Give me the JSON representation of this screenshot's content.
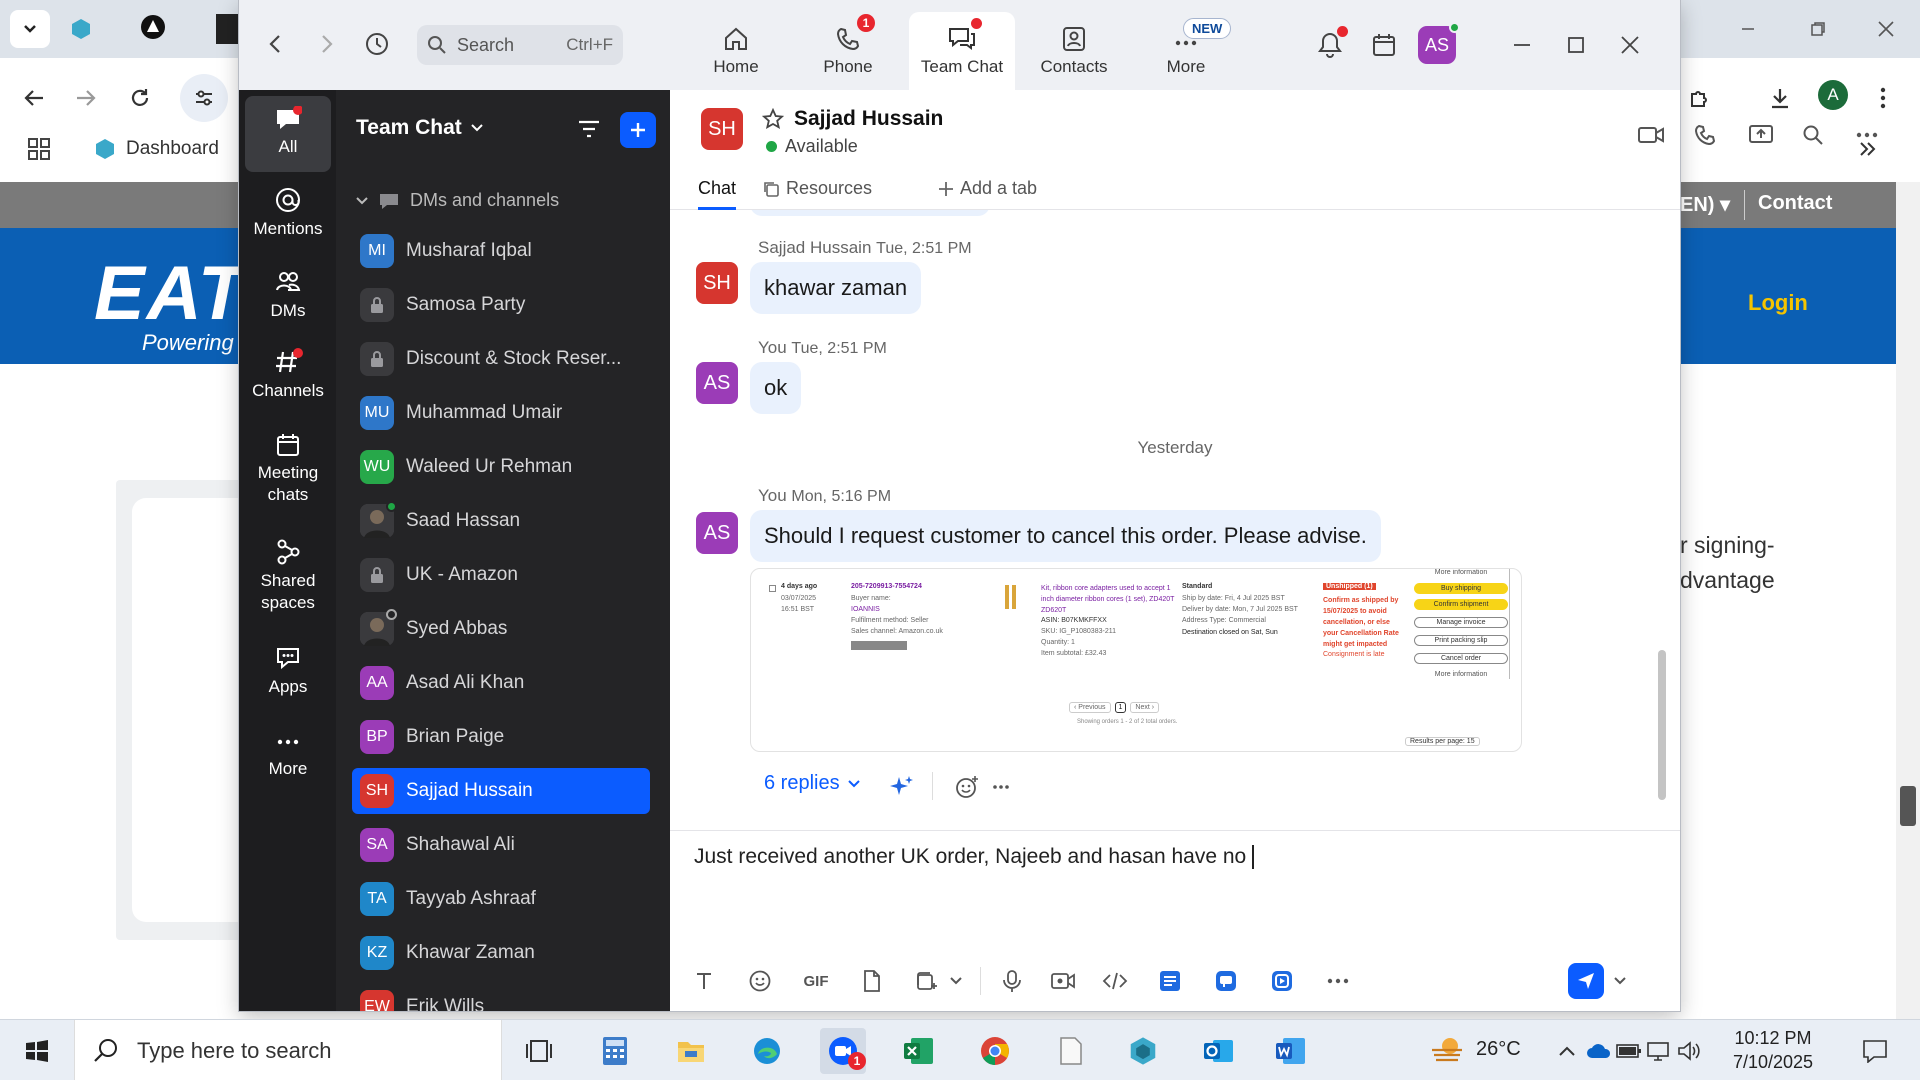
{
  "browser": {
    "bookmark_label": "Dashboard",
    "site_login": "Login",
    "site_contact": "Contact",
    "site_lang": "EN)",
    "site_logo_text": "EAT",
    "site_logo_sub": "Powering B",
    "site_side_text_1": "r signing-",
    "site_side_text_2": "dvantage"
  },
  "zoom": {
    "search_placeholder": "Search",
    "search_shortcut": "Ctrl+F",
    "nav": [
      {
        "label": "Home",
        "icon": "home-icon"
      },
      {
        "label": "Phone",
        "icon": "phone-icon",
        "badge": "1"
      },
      {
        "label": "Team Chat",
        "icon": "chat-icon"
      },
      {
        "label": "Contacts",
        "icon": "contacts-icon"
      },
      {
        "label": "More",
        "icon": "more-icon",
        "pill": "NEW"
      }
    ],
    "user_initials": "AS",
    "rail": [
      {
        "label": "All"
      },
      {
        "label": "Mentions"
      },
      {
        "label": "DMs"
      },
      {
        "label": "Channels"
      },
      {
        "label": "Meeting chats"
      },
      {
        "label": "Shared spaces"
      },
      {
        "label": "Apps"
      },
      {
        "label": "More"
      }
    ],
    "list_title": "Team Chat",
    "group_label": "DMs and channels",
    "contacts": [
      {
        "initials": "MI",
        "name": "Musharaf Iqbal",
        "color": "#2e77c9",
        "status": "green"
      },
      {
        "initials": "",
        "name": "Samosa Party",
        "lock": true
      },
      {
        "initials": "",
        "name": "Discount & Stock Reser...",
        "lock": true
      },
      {
        "initials": "MU",
        "name": "Muhammad Umair",
        "color": "#2e77c9",
        "status": "away"
      },
      {
        "initials": "WU",
        "name": "Waleed Ur Rehman",
        "color": "#27a84a",
        "status": "green"
      },
      {
        "initials": "",
        "name": "Saad Hassan",
        "photo": true,
        "status": "green"
      },
      {
        "initials": "",
        "name": "UK - Amazon",
        "lock": true
      },
      {
        "initials": "",
        "name": "Syed Abbas",
        "photo": true,
        "status": "away"
      },
      {
        "initials": "AA",
        "name": "Asad Ali Khan",
        "color": "#9b3cb7",
        "status": "green"
      },
      {
        "initials": "BP",
        "name": "Brian Paige",
        "color": "#9b3cb7",
        "status": "green"
      },
      {
        "initials": "SH",
        "name": "Sajjad Hussain",
        "color": "#d6362f",
        "status": "green",
        "active": true
      },
      {
        "initials": "SA",
        "name": "Shahawal Ali",
        "color": "#9b3cb7",
        "status": "green"
      },
      {
        "initials": "TA",
        "name": "Tayyab Ashraaf",
        "color": "#1f87c9",
        "status": "green"
      },
      {
        "initials": "KZ",
        "name": "Khawar Zaman",
        "color": "#1f87c9",
        "status": "green"
      },
      {
        "initials": "EW",
        "name": "Erik Wills",
        "color": "#d6362f",
        "status": "green"
      }
    ],
    "chat": {
      "contact_initials": "SH",
      "contact_name": "Sajjad Hussain",
      "contact_status": "Available",
      "tabs": {
        "chat": "Chat",
        "resources": "Resources",
        "add": "Add a tab"
      },
      "messages": [
        {
          "initials": "SH",
          "sender": "Sajjad Hussain",
          "time": "Tue, 2:51 PM",
          "text": "khawar zaman"
        },
        {
          "initials": "AS",
          "sender": "You",
          "time": "Tue, 2:51 PM",
          "text": "ok"
        },
        {
          "initials": "AS",
          "sender": "You",
          "time": "Mon, 5:16 PM",
          "text": "Should I request customer to cancel this order. Please advise."
        }
      ],
      "day_divider": "Yesterday",
      "replies": "6 replies",
      "compose_text": "Just received another UK order, Najeeb and hasan have no ",
      "screenshot": {
        "days": "4 days ago",
        "date": "03/07/2025",
        "time": "16:51 BST",
        "order_id": "205-7209913-7554724",
        "buyer_label": "Buyer name:",
        "buyer": "IOANNIS",
        "fulfil": "Fulfilment method: Seller",
        "channel": "Sales channel: Amazon.co.uk",
        "product": "Kit, ribbon core adapters used to accept 1 inch diameter ribbon cores (1 set), ZD420T ZD620T",
        "asin": "ASIN: B07KMKFFXX",
        "sku": "SKU: IG_P1080383-211",
        "qty": "Quantity: 1",
        "subtotal": "Item subtotal: £32.43",
        "ship_std": "Standard",
        "ship_by": "Ship by date: Fri, 4 Jul 2025 BST",
        "deliver_by": "Deliver by date: Mon, 7 Jul 2025 BST",
        "address": "Address Type: Commercial",
        "dest": "Destination closed on Sat, Sun",
        "unshipped": "Unshipped (1)",
        "warn": "Confirm as shipped by 15/07/2025 to avoid cancellation, or else your Cancellation Rate might get impacted",
        "late": "Consignment is late",
        "btns": [
          "More information",
          "Buy shipping",
          "Confirm shipment",
          "Manage invoice",
          "Print packing slip",
          "Cancel order",
          "More information"
        ],
        "prev": "Previous",
        "page": "1",
        "next": "Next",
        "showing": "Showing orders 1 - 2 of 2 total orders.",
        "per_page": "Results per page: 15"
      }
    }
  },
  "taskbar": {
    "search_placeholder": "Type here to search",
    "temp": "26°C",
    "time": "10:12 PM",
    "date": "7/10/2025",
    "zoom_badge": "1"
  }
}
